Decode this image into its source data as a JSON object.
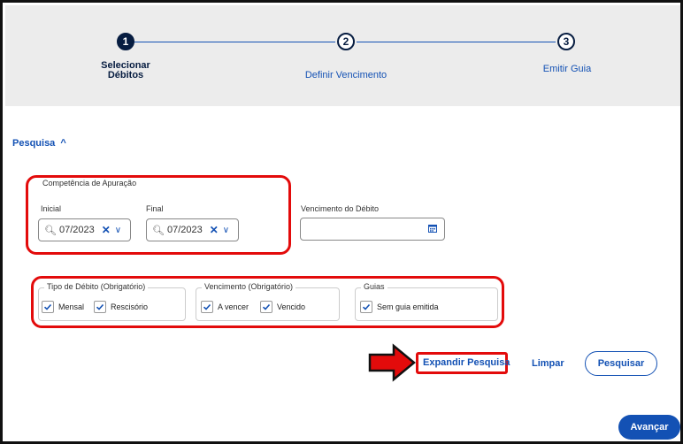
{
  "stepper": {
    "steps": [
      {
        "number": "1",
        "label_line1": "Selecionar",
        "label_line2": "Débitos"
      },
      {
        "number": "2",
        "label": "Definir Vencimento"
      },
      {
        "number": "3",
        "label": "Emitir Guia"
      }
    ]
  },
  "pesquisa": {
    "toggle_label": "Pesquisa",
    "toggle_icon": "^"
  },
  "competencia": {
    "legend": "Competência de Apuração",
    "inicial_label": "Inicial",
    "inicial_value": "07/2023",
    "final_label": "Final",
    "final_value": "07/2023"
  },
  "vencimento_debito": {
    "label": "Vencimento do Débito",
    "value": ""
  },
  "tipo_debito": {
    "legend": "Tipo de Débito (Obrigatório)",
    "options": [
      {
        "label": "Mensal",
        "checked": true
      },
      {
        "label": "Rescisório",
        "checked": true
      }
    ]
  },
  "vencimento_obrig": {
    "legend": "Vencimento (Obrigatório)",
    "options": [
      {
        "label": "A vencer",
        "checked": true
      },
      {
        "label": "Vencido",
        "checked": true
      }
    ]
  },
  "guias": {
    "legend": "Guias",
    "options": [
      {
        "label": "Sem guia emitida",
        "checked": true
      }
    ]
  },
  "actions": {
    "expandir": "Expandir Pesquisa",
    "limpar": "Limpar",
    "pesquisar": "Pesquisar",
    "avancar": "Avançar"
  },
  "colors": {
    "primary": "#1351b4",
    "annotation": "#e30b0b",
    "dark": "#071d41"
  }
}
